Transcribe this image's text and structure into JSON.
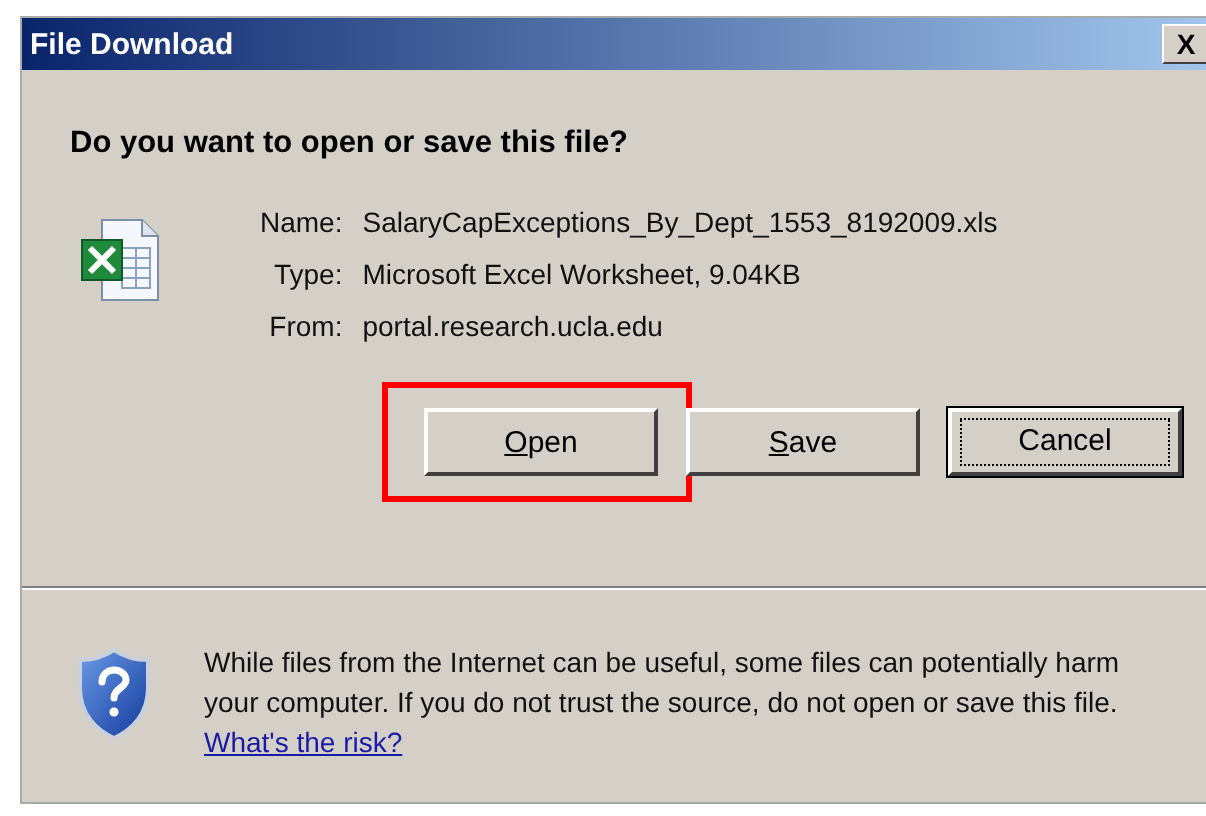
{
  "window": {
    "title": "File Download",
    "close": "X"
  },
  "heading": "Do you want to open or save this file?",
  "fields": [
    {
      "label": "Name:",
      "value": "SalaryCapExceptions_By_Dept_1553_8192009.xls"
    },
    {
      "label": "Type:",
      "value": "Microsoft Excel Worksheet, 9.04KB"
    },
    {
      "label": "From:",
      "value": "portal.research.ucla.edu"
    }
  ],
  "buttons": [
    {
      "label": "Open",
      "mnemonic": true,
      "default": false,
      "highlighted": true
    },
    {
      "label": "Save",
      "mnemonic": true,
      "default": false,
      "highlighted": false
    },
    {
      "label": "Cancel",
      "mnemonic": false,
      "default": true,
      "highlighted": false
    }
  ],
  "warning": {
    "text": "While files from the Internet can be useful, some files can potentially harm your computer. If you do not trust the source, do not open or save this file.",
    "link": "What's the risk?"
  }
}
